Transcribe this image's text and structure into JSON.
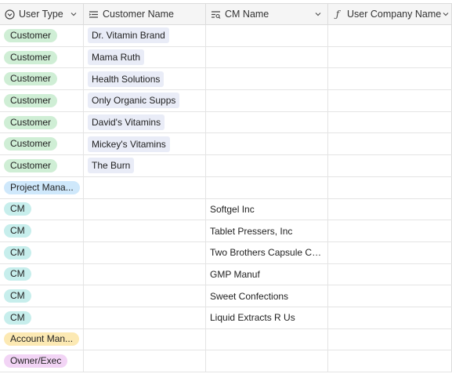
{
  "columns": [
    {
      "label": "User Type",
      "icon": "single-select-icon"
    },
    {
      "label": "Customer Name",
      "icon": "lookup-list-icon"
    },
    {
      "label": "CM Name",
      "icon": "search-field-icon"
    },
    {
      "label": "User Company Name",
      "icon": "formula-icon"
    }
  ],
  "colors": {
    "customer": "#cfeed5",
    "project_manager": "#cfe8fb",
    "cm": "#c7eeec",
    "account_manager": "#fce9b3",
    "owner_exec": "#f2d4f5",
    "linked_tag": "#e9ecf7"
  },
  "rows": [
    {
      "user_type": "Customer",
      "customer_name": "Dr. Vitamin Brand",
      "cm_name": "",
      "company": ""
    },
    {
      "user_type": "Customer",
      "customer_name": "Mama Ruth",
      "cm_name": "",
      "company": ""
    },
    {
      "user_type": "Customer",
      "customer_name": "Health Solutions",
      "cm_name": "",
      "company": ""
    },
    {
      "user_type": "Customer",
      "customer_name": "Only Organic Supps",
      "cm_name": "",
      "company": ""
    },
    {
      "user_type": "Customer",
      "customer_name": "David's Vitamins",
      "cm_name": "",
      "company": ""
    },
    {
      "user_type": "Customer",
      "customer_name": "Mickey's Vitamins",
      "cm_name": "",
      "company": ""
    },
    {
      "user_type": "Customer",
      "customer_name": "The Burn",
      "cm_name": "",
      "company": ""
    },
    {
      "user_type": "Project Mana...",
      "customer_name": "",
      "cm_name": "",
      "company": ""
    },
    {
      "user_type": "CM",
      "customer_name": "",
      "cm_name": "Softgel Inc",
      "company": ""
    },
    {
      "user_type": "CM",
      "customer_name": "",
      "cm_name": "Tablet Pressers, Inc",
      "company": ""
    },
    {
      "user_type": "CM",
      "customer_name": "",
      "cm_name": "Two Brothers Capsule Co...",
      "company": ""
    },
    {
      "user_type": "CM",
      "customer_name": "",
      "cm_name": "GMP Manuf",
      "company": ""
    },
    {
      "user_type": "CM",
      "customer_name": "",
      "cm_name": "Sweet Confections",
      "company": ""
    },
    {
      "user_type": "CM",
      "customer_name": "",
      "cm_name": "Liquid Extracts R Us",
      "company": ""
    },
    {
      "user_type": "Account Man...",
      "customer_name": "",
      "cm_name": "",
      "company": ""
    },
    {
      "user_type": "Owner/Exec",
      "customer_name": "",
      "cm_name": "",
      "company": ""
    }
  ]
}
